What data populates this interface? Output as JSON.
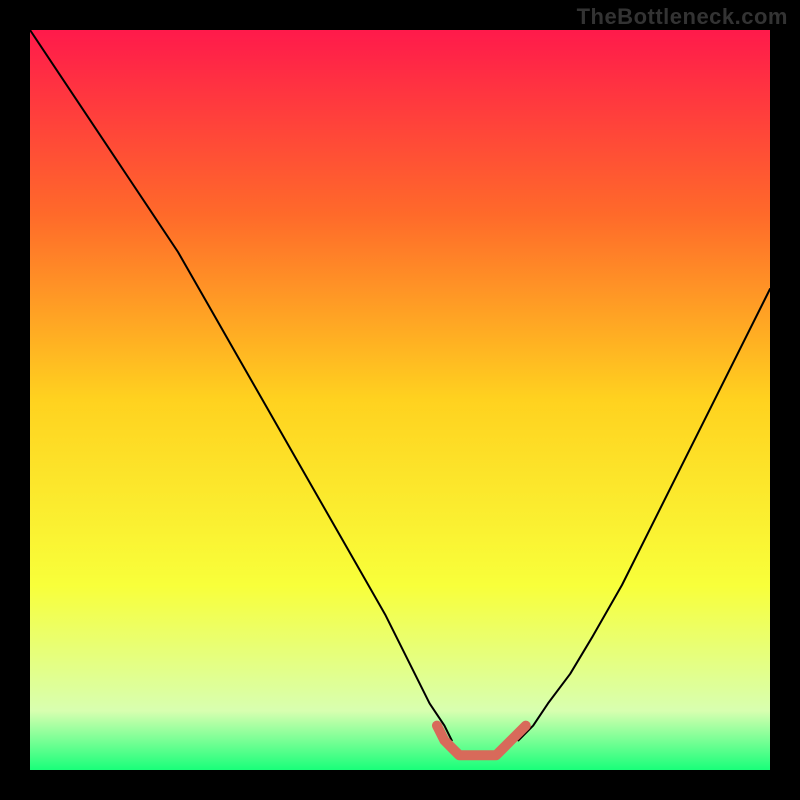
{
  "watermark": "TheBottleneck.com",
  "chart_data": {
    "type": "line",
    "title": "",
    "xlabel": "",
    "ylabel": "",
    "xlim": [
      0,
      100
    ],
    "ylim": [
      0,
      100
    ],
    "background_gradient": {
      "stops": [
        {
          "offset": 0.0,
          "color": "#ff1a4b"
        },
        {
          "offset": 0.25,
          "color": "#ff6a2a"
        },
        {
          "offset": 0.5,
          "color": "#ffd21f"
        },
        {
          "offset": 0.75,
          "color": "#f8ff3a"
        },
        {
          "offset": 0.92,
          "color": "#d8ffb0"
        },
        {
          "offset": 1.0,
          "color": "#19ff7a"
        }
      ]
    },
    "series": [
      {
        "name": "curve-left",
        "color": "#000000",
        "width": 2,
        "x": [
          0,
          4,
          8,
          12,
          16,
          20,
          24,
          28,
          32,
          36,
          40,
          44,
          48,
          50,
          52,
          54,
          56,
          57
        ],
        "y": [
          100,
          94,
          88,
          82,
          76,
          70,
          63,
          56,
          49,
          42,
          35,
          28,
          21,
          17,
          13,
          9,
          6,
          4
        ]
      },
      {
        "name": "curve-right",
        "color": "#000000",
        "width": 2,
        "x": [
          66,
          68,
          70,
          73,
          76,
          80,
          84,
          88,
          92,
          96,
          100
        ],
        "y": [
          4,
          6,
          9,
          13,
          18,
          25,
          33,
          41,
          49,
          57,
          65
        ]
      },
      {
        "name": "bottom-band",
        "color": "#d86a5a",
        "width": 10,
        "x": [
          55,
          56,
          57,
          58,
          59,
          60,
          61,
          62,
          63,
          64,
          65,
          66,
          67
        ],
        "y": [
          6,
          4,
          3,
          2,
          2,
          2,
          2,
          2,
          2,
          3,
          4,
          5,
          6
        ]
      }
    ]
  }
}
